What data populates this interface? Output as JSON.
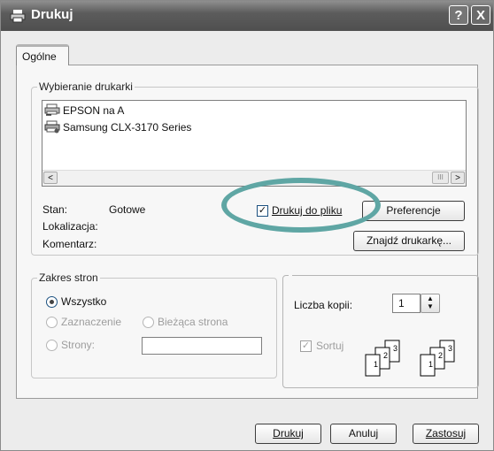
{
  "window": {
    "title": "Drukuj",
    "help_label": "?",
    "close_label": "X"
  },
  "tabs": [
    {
      "label": "Ogólne",
      "active": true
    }
  ],
  "printer_group": {
    "legend": "Wybieranie drukarki",
    "printers": [
      {
        "name": "EPSON na A",
        "icon": "network-printer-icon"
      },
      {
        "name": "Samsung CLX-3170 Series",
        "icon": "printer-icon"
      }
    ],
    "scroll_left": "<",
    "scroll_right": ">",
    "scroll_thumb": "III"
  },
  "status": {
    "status_label": "Stan:",
    "status_value": "Gotowe",
    "location_label": "Lokalizacja:",
    "comment_label": "Komentarz:"
  },
  "print_to_file": {
    "label": "Drukuj do pliku",
    "checked": true
  },
  "buttons": {
    "preferences": "Preferencje",
    "find_printer": "Znajdź drukarkę...",
    "print": "Drukuj",
    "cancel": "Anuluj",
    "apply": "Zastosuj"
  },
  "page_range": {
    "legend": "Zakres stron",
    "all": "Wszystko",
    "selection": "Zaznaczenie",
    "current_page": "Bieżąca strona",
    "pages": "Strony:",
    "selected": "all"
  },
  "copies": {
    "label": "Liczba kopii:",
    "value": "1",
    "collate_label": "Sortuj",
    "collate_checked": true,
    "collate_pages": [
      "1",
      "2",
      "3",
      "1",
      "2",
      "3"
    ]
  },
  "annotation": {
    "color": "#5fa6a4"
  }
}
